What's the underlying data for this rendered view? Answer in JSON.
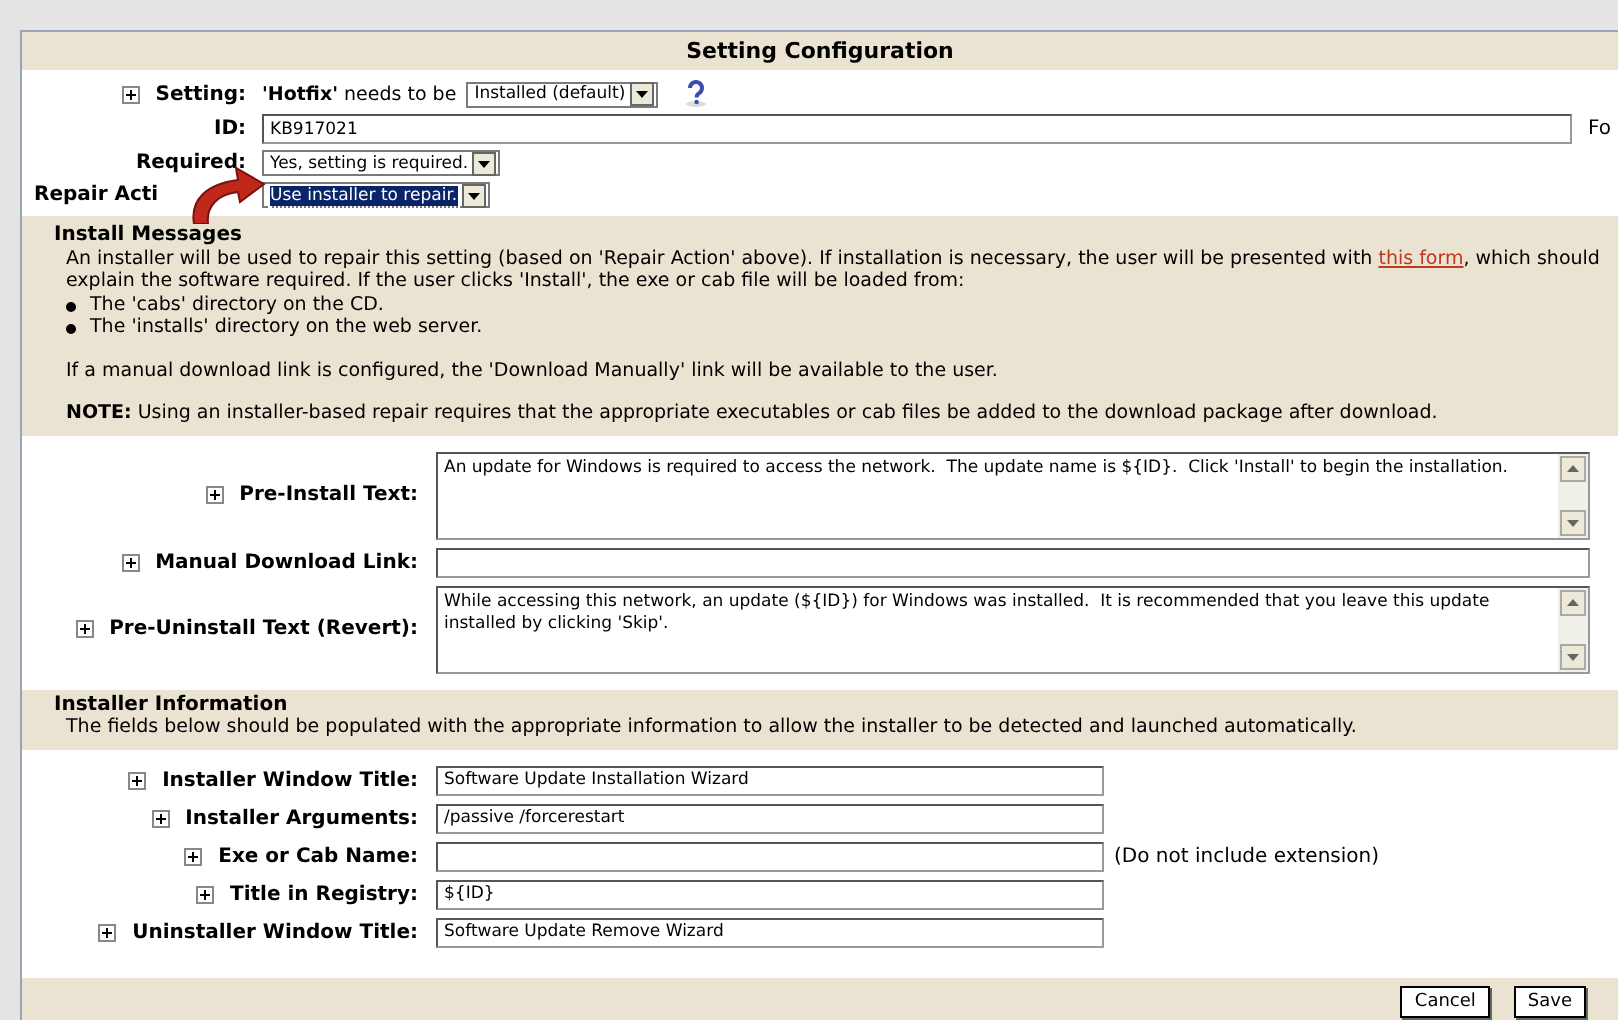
{
  "title": "Setting Configuration",
  "setting": {
    "label": "Setting:",
    "text": "**'Hotfix'** needs to be",
    "value": "Installed (default)"
  },
  "id": {
    "label": "ID:",
    "value": "KB917021",
    "trailing": "Fo"
  },
  "required": {
    "label": "Required:",
    "value": "Yes, setting is required."
  },
  "repair_action": {
    "label": "Repair Acti",
    "value": "Use installer to repair.",
    "selected": true
  },
  "install_messages": {
    "heading": "Install Messages",
    "intro_start": "An installer will be used to repair this setting (based on 'Repair Action' above). If installation is necessary, the user will be presented with",
    "link": "this form",
    "intro_end": ", which should explain the software required. If the user clicks 'Install', the exe or cab file will be loaded from:",
    "bullets": [
      "The 'cabs' directory on the CD.",
      "The 'installs' directory on the web server."
    ],
    "manual_note": "If a manual download link is configured, the 'Download Manually' link will be available to the user.",
    "note": "**NOTE:** Using an installer-based repair requires that the appropriate executables or cab files be added to the download package after download."
  },
  "install_fields": [
    {
      "label": "Pre-Install Text:",
      "kind": "textarea",
      "value": "An update for Windows is required to access the network.  The update name is ${ID}.  Click 'Install' to begin the installation."
    },
    {
      "label": "Manual Download Link:",
      "kind": "input"
    },
    {
      "label": "Pre-Uninstall Text (Revert):",
      "kind": "textarea",
      "value": "While accessing this network, an update (${ID}) for Windows was installed.  It is recommended that you leave this update installed by clicking 'Skip'."
    }
  ],
  "installer_information": {
    "heading": "Installer Information",
    "description": "The fields below should be populated with the appropriate information to allow the installer to be detected and launched automatically.",
    "fields": [
      {
        "label": "Installer Window Title:",
        "value": "Software Update Installation Wizard"
      },
      {
        "label": "Installer Arguments:",
        "value": "/passive /forcerestart"
      },
      {
        "label": "Exe or Cab Name:",
        "hint": "(Do not include extension)"
      },
      {
        "label": "Title in Registry:",
        "value": "${ID}"
      },
      {
        "label": "Uninstaller Window Title:",
        "value": "Software Update Remove Wizard"
      }
    ]
  },
  "buttons": [
    "Cancel",
    "Save"
  ]
}
